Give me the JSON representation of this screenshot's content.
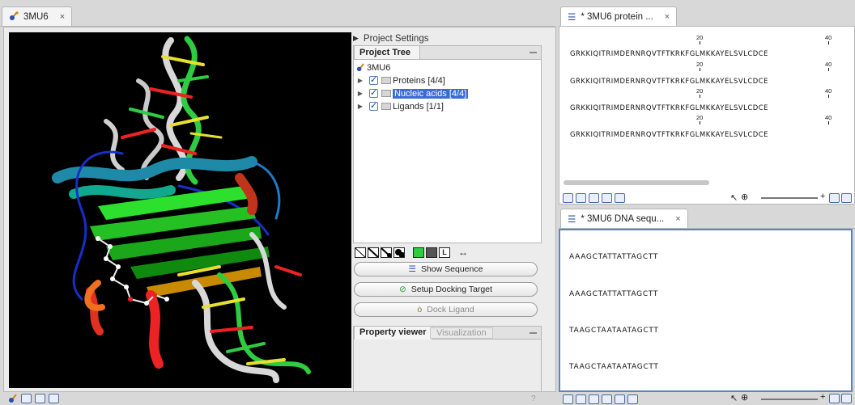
{
  "left_tab": {
    "title": "3MU6",
    "close": "×"
  },
  "side": {
    "settings_label": "Project Settings",
    "tree_tab": "Project Tree",
    "tree_root": "3MU6",
    "tree_items": [
      {
        "label": "Proteins [4/4]",
        "selected": false
      },
      {
        "label": "Nucleic acids [4/4]",
        "selected": true
      },
      {
        "label": "Ligands [1/1]",
        "selected": false
      }
    ],
    "buttons": {
      "show_sequence": "Show Sequence",
      "setup_docking": "Setup Docking Target",
      "dock_ligand": "Dock Ligand"
    },
    "property_tab": "Property viewer",
    "visualization_tab": "Visualization",
    "bottom_help": "?"
  },
  "protein_editor": {
    "tab_title": "* 3MU6 protein ...",
    "close": "×",
    "sequence": "GRKKIQITRIMDERNRQVTFTKRKFGLMKKAYELSVLCDCE",
    "ruler_labels": [
      "20",
      "40"
    ],
    "rows": 4
  },
  "dna_editor": {
    "tab_title": "* 3MU6 DNA sequ...",
    "close": "×",
    "sequences": [
      "AAAGCTATTATTAGCTT",
      "AAAGCTATTATTAGCTT",
      "TAAGCTAATAATAGCTT",
      "TAAGCTAATAATAGCTT"
    ]
  },
  "colors": {
    "selection": "#3c6bd5",
    "focus_border": "#5e82c9",
    "viewer_bg": "#000000"
  },
  "icons": [
    "molecule-icon",
    "checkbox-icon",
    "folder-icon",
    "sequence-icon",
    "docking-icon",
    "ligand-icon",
    "zoom-icon",
    "select-arrow-icon"
  ]
}
